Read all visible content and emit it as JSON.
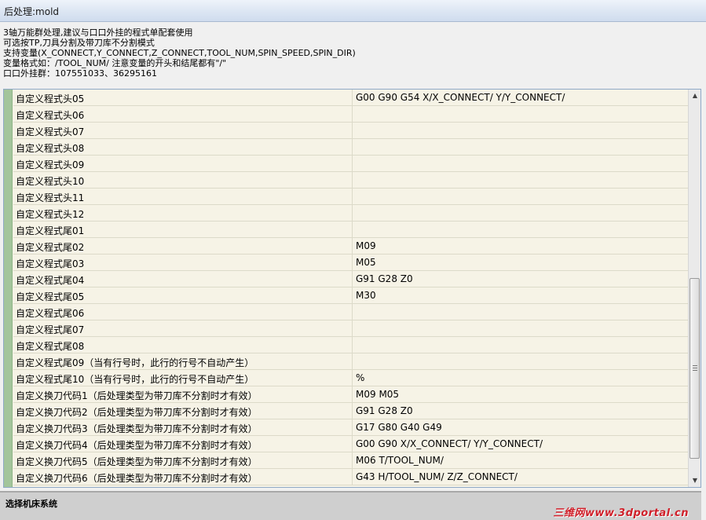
{
  "window": {
    "title": "后处理:mold"
  },
  "info_lines": [
    "3轴万能群处理,建议与口口外挂的程式单配套使用",
    "可选按TP,刀具分割及带刀库不分割模式",
    "支持变量(X_CONNECT,Y_CONNECT,Z_CONNECT,TOOL_NUM,SPIN_SPEED,SPIN_DIR)",
    "变量格式如：/TOOL_NUM/ 注意变量的开头和结尾都有\"/\"",
    "口口外挂群：107551033、36295161"
  ],
  "grid": {
    "rows": [
      {
        "name": "自定义程式头05",
        "value": "G00 G90 G54 X/X_CONNECT/ Y/Y_CONNECT/"
      },
      {
        "name": "自定义程式头06",
        "value": ""
      },
      {
        "name": "自定义程式头07",
        "value": ""
      },
      {
        "name": "自定义程式头08",
        "value": ""
      },
      {
        "name": "自定义程式头09",
        "value": ""
      },
      {
        "name": "自定义程式头10",
        "value": ""
      },
      {
        "name": "自定义程式头11",
        "value": ""
      },
      {
        "name": "自定义程式头12",
        "value": ""
      },
      {
        "name": "自定义程式尾01",
        "value": ""
      },
      {
        "name": "自定义程式尾02",
        "value": "M09"
      },
      {
        "name": "自定义程式尾03",
        "value": "M05"
      },
      {
        "name": "自定义程式尾04",
        "value": "G91 G28 Z0"
      },
      {
        "name": "自定义程式尾05",
        "value": "M30"
      },
      {
        "name": "自定义程式尾06",
        "value": ""
      },
      {
        "name": "自定义程式尾07",
        "value": ""
      },
      {
        "name": "自定义程式尾08",
        "value": ""
      },
      {
        "name": "自定义程式尾09（当有行号时，此行的行号不自动产生）",
        "value": ""
      },
      {
        "name": "自定义程式尾10（当有行号时，此行的行号不自动产生）",
        "value": "%"
      },
      {
        "name": "自定义换刀代码1（后处理类型为带刀库不分割时才有效）",
        "value": "M09 M05"
      },
      {
        "name": "自定义换刀代码2（后处理类型为带刀库不分割时才有效）",
        "value": "G91 G28 Z0"
      },
      {
        "name": "自定义换刀代码3（后处理类型为带刀库不分割时才有效）",
        "value": "G17 G80 G40 G49"
      },
      {
        "name": "自定义换刀代码4（后处理类型为带刀库不分割时才有效）",
        "value": "G00 G90 X/X_CONNECT/ Y/Y_CONNECT/"
      },
      {
        "name": "自定义换刀代码5（后处理类型为带刀库不分割时才有效）",
        "value": "M06 T/TOOL_NUM/"
      },
      {
        "name": "自定义换刀代码6（后处理类型为带刀库不分割时才有效）",
        "value": "G43 H/TOOL_NUM/ Z/Z_CONNECT/"
      }
    ]
  },
  "scrollbar": {
    "up_icon": "▲",
    "down_icon": "▼"
  },
  "bottom_panel": {
    "title": "选择机床系统",
    "watermark": "三维网www.3dportal.cn"
  },
  "colors": {
    "grid_background": "#f6f3e6",
    "gutter": "#a3c59b",
    "watermark": "#d0202a"
  }
}
